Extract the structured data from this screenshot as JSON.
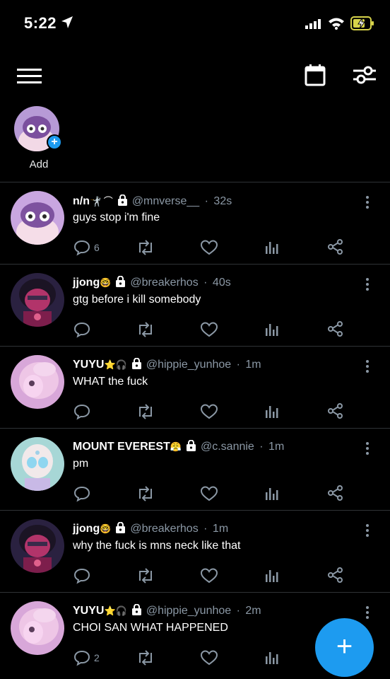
{
  "status_bar": {
    "time": "5:22"
  },
  "story": {
    "add_label": "Add"
  },
  "colors": {
    "accent": "#1d9bf0",
    "muted": "#8b98a5",
    "background": "#000000"
  },
  "posts": [
    {
      "name": "n/n",
      "emoji": "🤺 ⌒",
      "handle": "@mnverse__",
      "time": "32s",
      "text": "guys stop i'm fine",
      "replies": "6",
      "avatar": "purple-hair-character"
    },
    {
      "name": "jjong",
      "emoji": "🤓",
      "handle": "@breakerhos",
      "time": "40s",
      "text": "gtg before i kill somebody",
      "replies": "",
      "avatar": "garnet-character"
    },
    {
      "name": "YUYU",
      "emoji": "⭐🎧",
      "handle": "@hippie_yunhoe",
      "time": "1m",
      "text": "WHAT the fuck",
      "replies": "",
      "avatar": "pink-hair-character"
    },
    {
      "name": "MOUNT EVEREST",
      "emoji": "😤",
      "handle": "@c.sannie",
      "time": "1m",
      "text": "pm",
      "replies": "",
      "avatar": "pearl-character"
    },
    {
      "name": "jjong",
      "emoji": "🤓",
      "handle": "@breakerhos",
      "time": "1m",
      "text": "why the fuck is mns neck like that",
      "replies": "",
      "avatar": "garnet-character"
    },
    {
      "name": "YUYU",
      "emoji": "⭐🎧",
      "handle": "@hippie_yunhoe",
      "time": "2m",
      "text": "CHOI SAN WHAT HAPPENED",
      "replies": "2",
      "avatar": "pink-hair-character"
    }
  ]
}
